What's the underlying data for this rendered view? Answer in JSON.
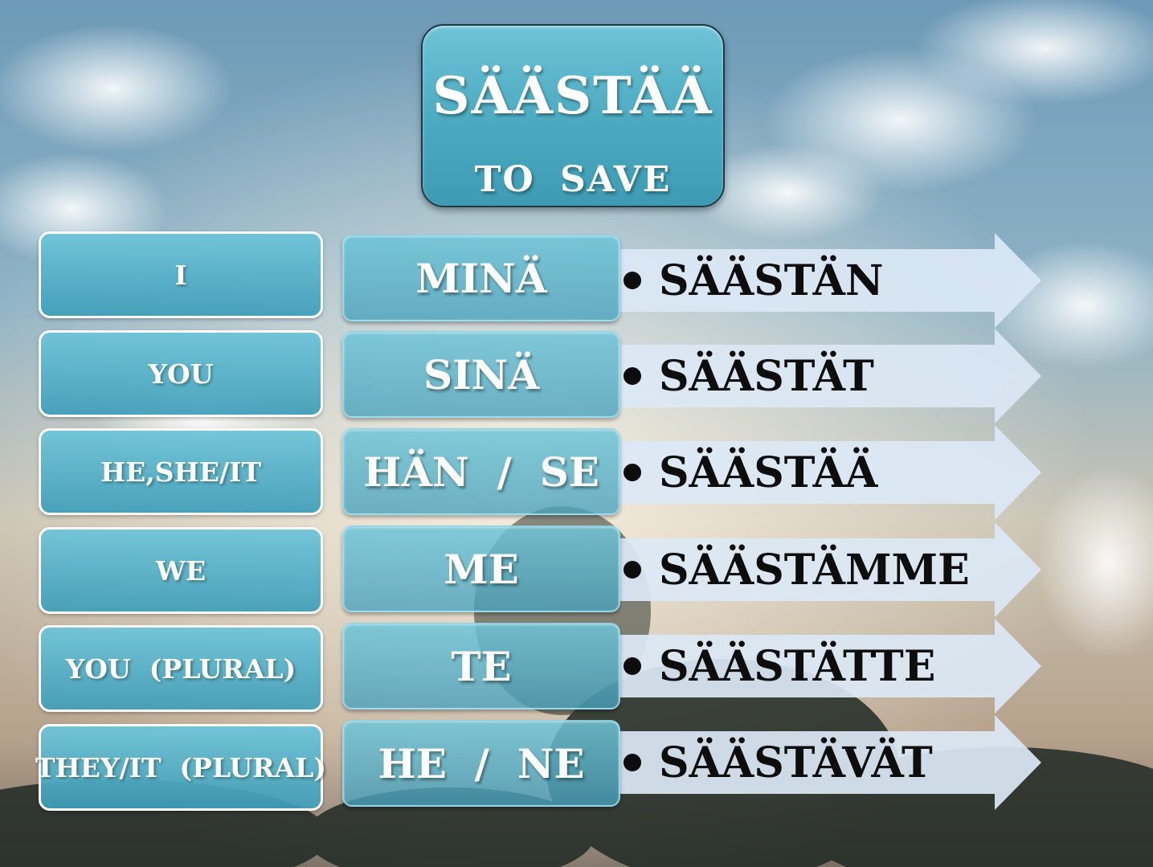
{
  "title": {
    "verb": "SÄÄSTÄÄ",
    "translation": "TO  SAVE"
  },
  "rows": [
    {
      "english": "I",
      "finnish": "MINÄ",
      "form": "SÄÄSTÄN"
    },
    {
      "english": "YOU",
      "finnish": "SINÄ",
      "form": "SÄÄSTÄT"
    },
    {
      "english": "HE,SHE/IT",
      "finnish": "HÄN  /  SE",
      "form": "SÄÄSTÄÄ"
    },
    {
      "english": "WE",
      "finnish": "ME",
      "form": "SÄÄSTÄMME"
    },
    {
      "english": "YOU  (PLURAL)",
      "finnish": "TE",
      "form": "SÄÄSTÄTTE"
    },
    {
      "english": "THEY/IT  (PLURAL)",
      "finnish": "HE  /  NE",
      "form": "SÄÄSTÄVÄT"
    }
  ],
  "colors": {
    "tile": "#4aa9c0",
    "arrow": "#dbe8f5",
    "text_dark": "#0d0d0d"
  }
}
